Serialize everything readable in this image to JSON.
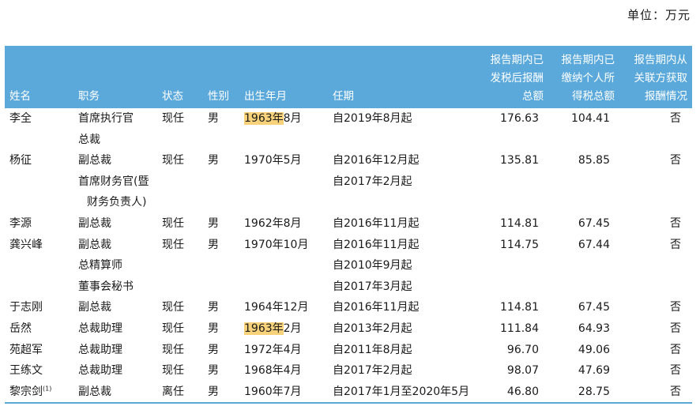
{
  "unit_label": "单位：万元",
  "headers": {
    "name": "姓名",
    "position": "职务",
    "status": "状态",
    "gender": "性别",
    "birth": "出生年月",
    "term": "任期",
    "pay_lines": [
      "报告期内已",
      "发税后报酬",
      "总额"
    ],
    "tax_lines": [
      "报告期内已",
      "缴纳个人所",
      "得税总额"
    ],
    "related_lines": [
      "报告期内从",
      "关联方获取",
      "报酬情况"
    ]
  },
  "rows": [
    {
      "name": "李全",
      "positions": [
        "首席执行官",
        "总裁"
      ],
      "status": "现任",
      "gender": "男",
      "birth_year": "1963年",
      "birth_month": "8月",
      "terms": [
        "自2019年8月起"
      ],
      "pay": "176.63",
      "tax": "104.41",
      "related": "否"
    },
    {
      "name": "杨征",
      "positions": [
        "副总裁",
        "首席财务官(暨",
        "财务负责人)"
      ],
      "status": "现任",
      "gender": "男",
      "birth_year": "1970年",
      "birth_month": "5月",
      "terms": [
        "自2016年12月起",
        "自2017年2月起"
      ],
      "pay": "135.81",
      "tax": "85.85",
      "related": "否"
    },
    {
      "name": "李源",
      "positions": [
        "副总裁"
      ],
      "status": "现任",
      "gender": "男",
      "birth_year": "1962年",
      "birth_month": "8月",
      "terms": [
        "自2016年11月起"
      ],
      "pay": "114.81",
      "tax": "67.45",
      "related": "否"
    },
    {
      "name": "龚兴峰",
      "positions": [
        "副总裁",
        "总精算师",
        "董事会秘书"
      ],
      "status": "现任",
      "gender": "男",
      "birth_year": "1970年",
      "birth_month": "10月",
      "terms": [
        "自2016年11月起",
        "自2010年9月起",
        "自2017年3月起"
      ],
      "pay": "114.75",
      "tax": "67.44",
      "related": "否"
    },
    {
      "name": "于志刚",
      "positions": [
        "副总裁"
      ],
      "status": "现任",
      "gender": "男",
      "birth_year": "1964年",
      "birth_month": "12月",
      "terms": [
        "自2016年11月起"
      ],
      "pay": "114.81",
      "tax": "67.45",
      "related": "否"
    },
    {
      "name": "岳然",
      "positions": [
        "总裁助理"
      ],
      "status": "现任",
      "gender": "男",
      "birth_year": "1963年",
      "birth_month": "2月",
      "terms": [
        "自2013年2月起"
      ],
      "pay": "111.84",
      "tax": "64.93",
      "related": "否"
    },
    {
      "name": "苑超军",
      "positions": [
        "总裁助理"
      ],
      "status": "现任",
      "gender": "男",
      "birth_year": "1972年",
      "birth_month": "4月",
      "terms": [
        "自2011年8月起"
      ],
      "pay": "96.70",
      "tax": "49.06",
      "related": "否"
    },
    {
      "name": "王练文",
      "positions": [
        "总裁助理"
      ],
      "status": "现任",
      "gender": "男",
      "birth_year": "1968年",
      "birth_month": "4月",
      "terms": [
        "自2017年2月起"
      ],
      "pay": "98.07",
      "tax": "47.69",
      "related": "否"
    },
    {
      "name": "黎宗剑",
      "name_note": "(1)",
      "positions": [
        "副总裁"
      ],
      "status": "离任",
      "gender": "男",
      "birth_year": "1960年",
      "birth_month": "7月",
      "terms": [
        "自2017年1月至2020年5月"
      ],
      "pay": "46.80",
      "tax": "28.75",
      "related": "否"
    }
  ],
  "colors": {
    "header_bg": "#5aa9da",
    "header_text": "#ffffff",
    "highlight": "#f7d27a"
  },
  "highlighted_cells": [
    "row0.birth_year",
    "row5.birth_year"
  ]
}
